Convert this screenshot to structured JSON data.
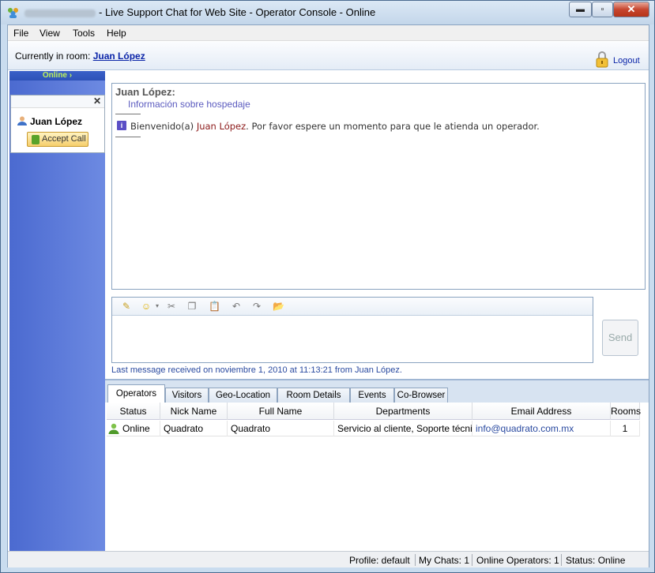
{
  "window": {
    "title": "- Live Support Chat for Web Site - Operator Console - Online"
  },
  "menu": [
    "File",
    "View",
    "Tools",
    "Help"
  ],
  "room": {
    "label": "Currently in room:",
    "name": "Juan López",
    "logout": "Logout"
  },
  "sidebar": {
    "header": "Online ›",
    "visitor_name": "Juan López",
    "accept_call": "Accept Call"
  },
  "chat": {
    "sender": "Juan López:",
    "topic": "Información sobre hospedaje",
    "welcome_prefix": "Bienvenido(a) ",
    "welcome_name": "Juan López",
    "welcome_suffix": ". Por favor espere un momento para que le atienda un operador."
  },
  "composer": {
    "send": "Send",
    "last_message": "Last message received on noviembre 1, 2010 at 11:13:21 from Juan López."
  },
  "tabs": [
    "Operators",
    "Visitors",
    "Geo-Location",
    "Room Details",
    "Events",
    "Co-Browser"
  ],
  "operators": {
    "columns": [
      "Status",
      "Nick Name",
      "Full Name",
      "Departments",
      "Email Address",
      "Rooms"
    ],
    "rows": [
      {
        "status": "Online",
        "nick": "Quadrato",
        "full": "Quadrato",
        "departments": "Servicio al cliente, Soporte técnico",
        "email": "info@quadrato.com.mx",
        "rooms": "1"
      }
    ]
  },
  "statusbar": {
    "profile": "Profile: default",
    "my_chats": "My Chats: 1",
    "online_operators": "Online Operators: 1",
    "status": "Status: Online"
  }
}
